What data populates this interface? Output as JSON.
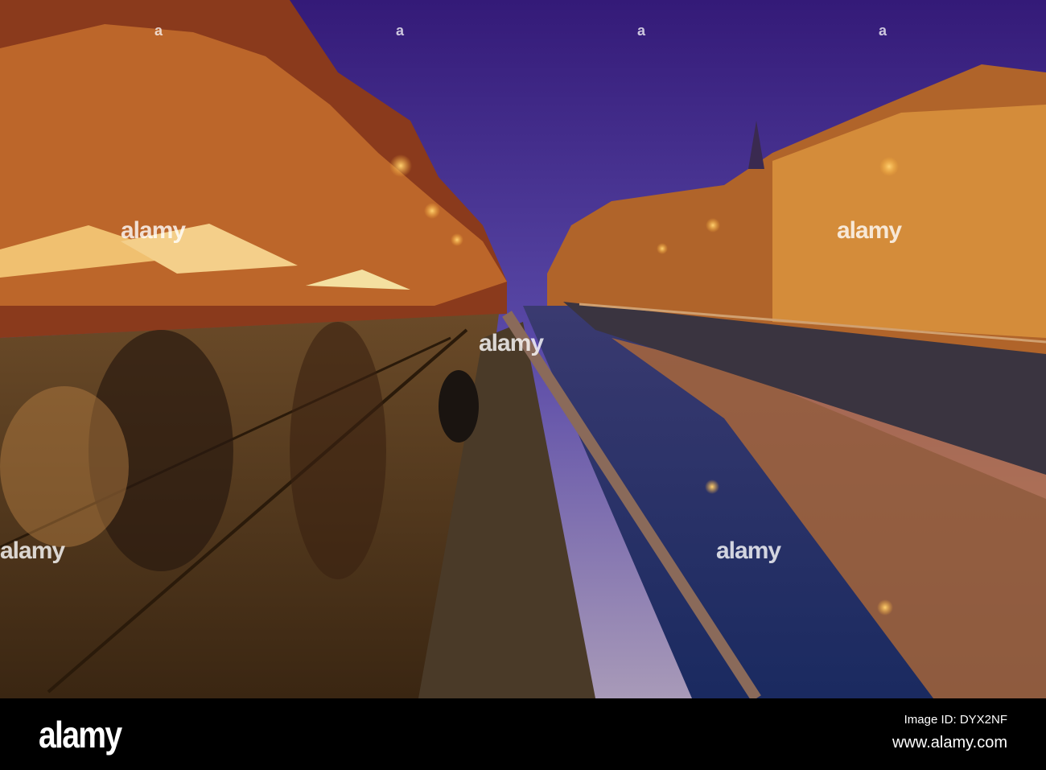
{
  "watermark": {
    "text": "alamy",
    "corner_mark": "a"
  },
  "footer": {
    "logo": "alamy",
    "image_id": "Image ID: DYX2NF",
    "website": "www.alamy.com"
  },
  "colors": {
    "sky_top": "#3a1f7a",
    "sky_horizon": "#8a86c0",
    "lamp": "#ffb43a",
    "building": "#c87a2a"
  }
}
